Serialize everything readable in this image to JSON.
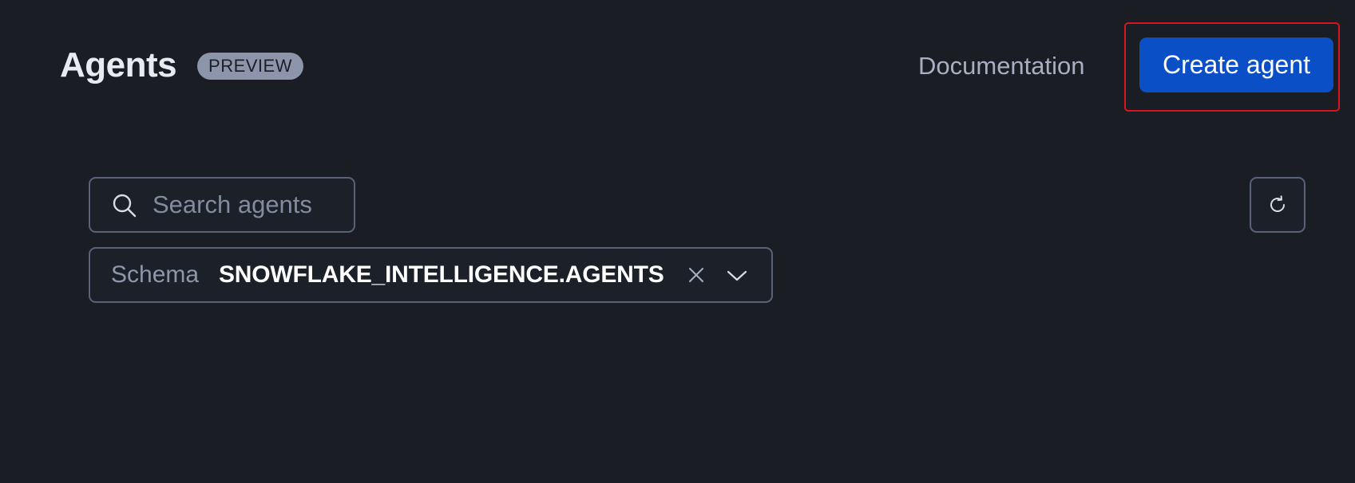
{
  "header": {
    "title": "Agents",
    "badge": "PREVIEW",
    "documentation_label": "Documentation",
    "create_label": "Create agent"
  },
  "search": {
    "placeholder": "Search agents",
    "value": "",
    "icon": "search-icon"
  },
  "refresh": {
    "icon": "refresh-icon"
  },
  "schema_filter": {
    "label": "Schema",
    "value": "SNOWFLAKE_INTELLIGENCE.AGENTS",
    "clear_icon": "close-icon",
    "expand_icon": "chevron-down-icon"
  },
  "colors": {
    "background": "#1a1d24",
    "primary_button": "#0b4fc7",
    "badge": "#8d95ab",
    "focus_outline": "#d8141c",
    "border": "#596277"
  }
}
